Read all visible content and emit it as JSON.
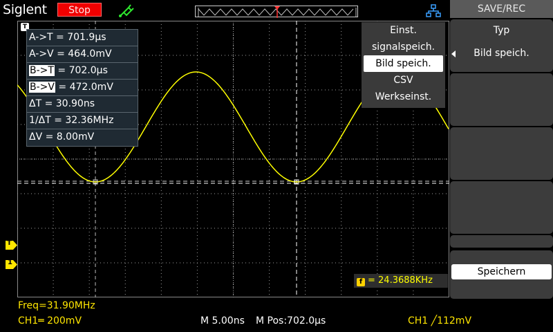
{
  "header": {
    "brand": "Siglent",
    "run_state": "Stop"
  },
  "trigger_marker": "T",
  "measurements": [
    {
      "prefix": "",
      "hl": "",
      "text": "A->T = 701.9µs"
    },
    {
      "prefix": "",
      "hl": "",
      "text": "A->V = 464.0mV"
    },
    {
      "prefix": "B->",
      "hl": "T",
      "text": " = 702.0µs"
    },
    {
      "prefix": "B->",
      "hl": "V",
      "text": " = 472.0mV"
    },
    {
      "prefix": "",
      "hl": "",
      "text": "ΔT = 30.90ns"
    },
    {
      "prefix": "",
      "hl": "",
      "text": "1/ΔT = 32.36MHz"
    },
    {
      "prefix": "",
      "hl": "",
      "text": "ΔV = 8.00mV"
    }
  ],
  "save_popup": {
    "items": [
      "Einst.",
      "signalspeich.",
      "Bild speich.",
      "CSV",
      "Werkseinst."
    ],
    "selected_index": 2
  },
  "side_menu": {
    "title": "SAVE/REC",
    "type_label": "Typ",
    "type_value": "Bild speich.",
    "save_button": "Speichern"
  },
  "channel_markers": {
    "trigger_level": "T",
    "ch1": "1"
  },
  "freq_counter": {
    "badge": "f",
    "value": "= 24.3688KHz"
  },
  "status_bar": {
    "freq": "Freq=31.90MHz",
    "ch1_coupling": "CH1═ 200mV",
    "timebase": "M 5.00ns",
    "mpos": "M Pos:702.0µs",
    "trigger": "CH1 ╱112mV"
  },
  "colors": {
    "trace": "#ffff00",
    "accent_stop": "#f00000",
    "grid": "#a0a0a0"
  }
}
